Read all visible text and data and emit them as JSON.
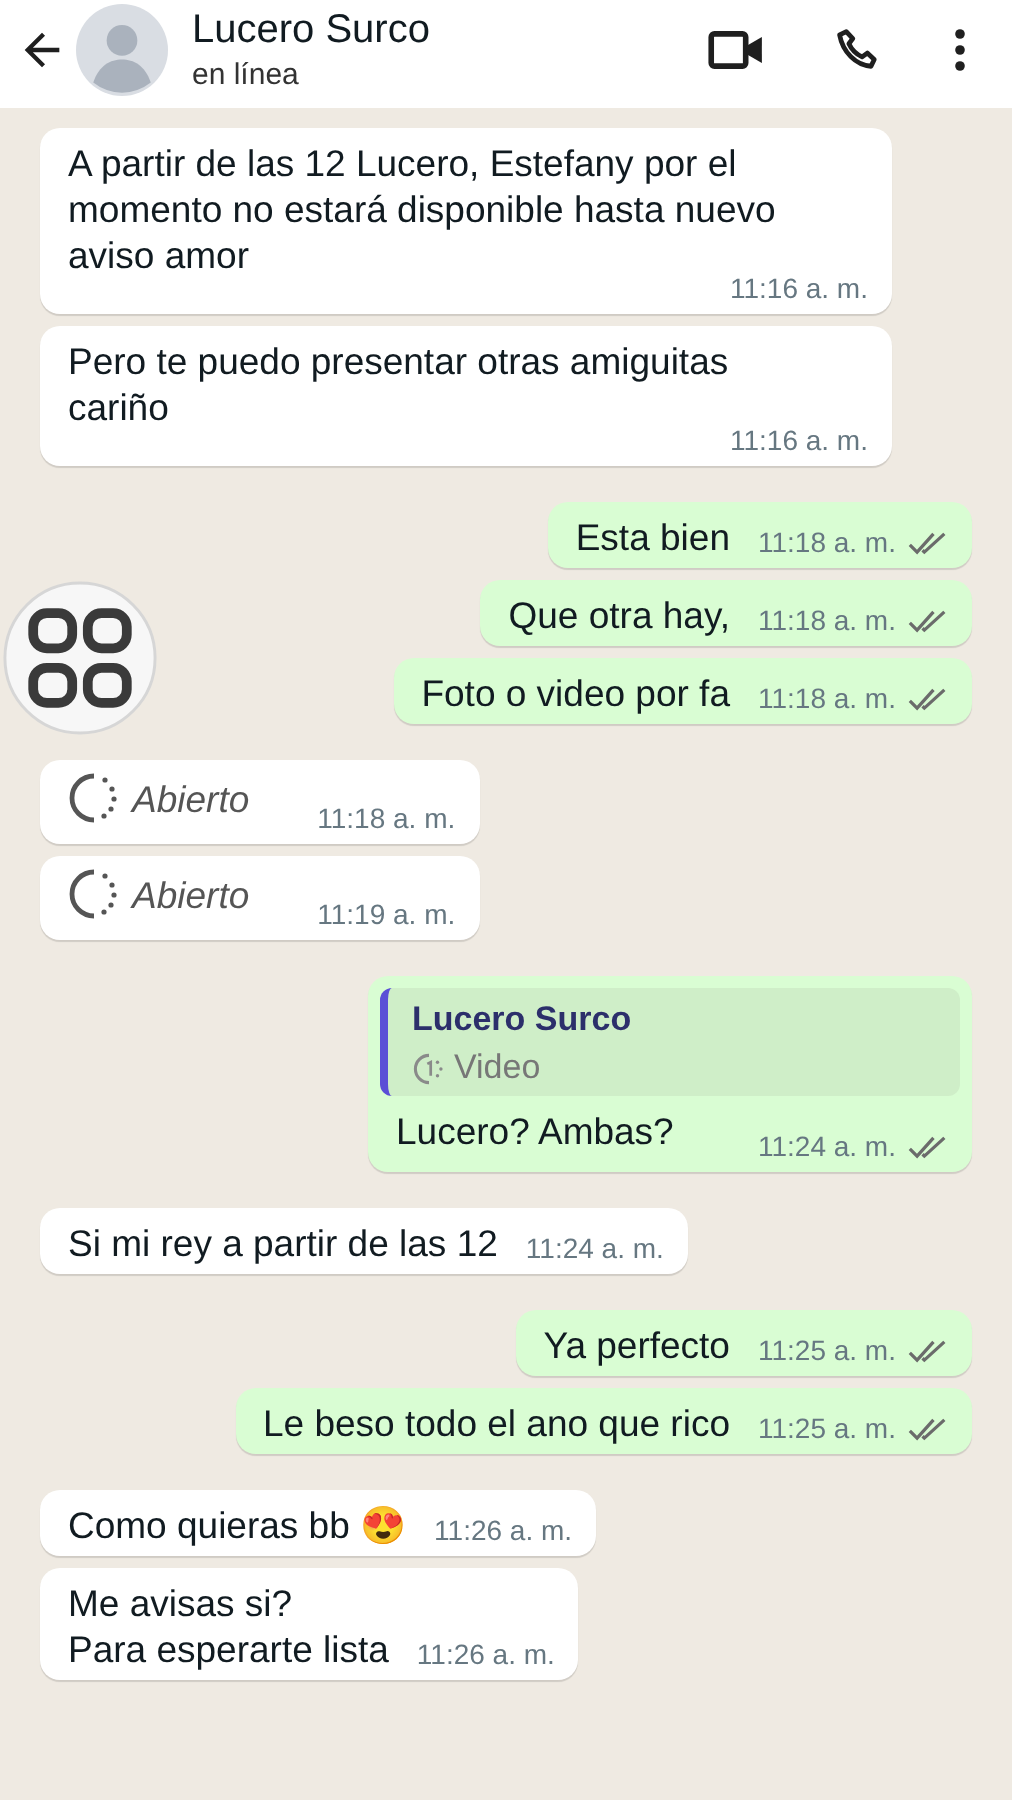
{
  "header": {
    "contact_name": "Lucero Surco",
    "status": "en línea"
  },
  "messages": [
    {
      "kind": "text",
      "outgoing": false,
      "text": "A partir de las 12 Lucero, Estefany por el momento no estará disponible hasta nuevo aviso amor",
      "time": "11:16 a. m."
    },
    {
      "kind": "text",
      "outgoing": false,
      "text": "Pero te puedo presentar otras amiguitas cariño",
      "time": "11:16 a. m."
    },
    {
      "kind": "text",
      "outgoing": true,
      "delivered": true,
      "text": "Esta bien",
      "time": "11:18 a. m."
    },
    {
      "kind": "text",
      "outgoing": true,
      "delivered": true,
      "text": "Que otra hay,",
      "time": "11:18 a. m."
    },
    {
      "kind": "text",
      "outgoing": true,
      "delivered": true,
      "text": "Foto o video por fa",
      "time": "11:18 a. m."
    },
    {
      "kind": "view_once",
      "outgoing": false,
      "text": "Abierto",
      "time": "11:18 a. m."
    },
    {
      "kind": "view_once",
      "outgoing": false,
      "text": "Abierto",
      "time": "11:19 a. m."
    },
    {
      "kind": "reply",
      "outgoing": true,
      "delivered": true,
      "quote_author": "Lucero Surco",
      "quote_text": "Video",
      "text": "Lucero? Ambas?",
      "time": "11:24 a. m."
    },
    {
      "kind": "text",
      "outgoing": false,
      "text": "Si mi rey a partir de las 12",
      "time": "11:24 a. m."
    },
    {
      "kind": "text",
      "outgoing": true,
      "delivered": true,
      "text": "Ya perfecto",
      "time": "11:25 a. m."
    },
    {
      "kind": "text",
      "outgoing": true,
      "delivered": true,
      "text": "Le beso todo el ano que rico",
      "time": "11:25 a. m."
    },
    {
      "kind": "text",
      "outgoing": false,
      "text": "Como quieras bb 😍",
      "time": "11:26 a. m."
    },
    {
      "kind": "text",
      "outgoing": false,
      "text": "Me avisas si?\nPara esperarte lista",
      "time": "11:26 a. m."
    }
  ]
}
